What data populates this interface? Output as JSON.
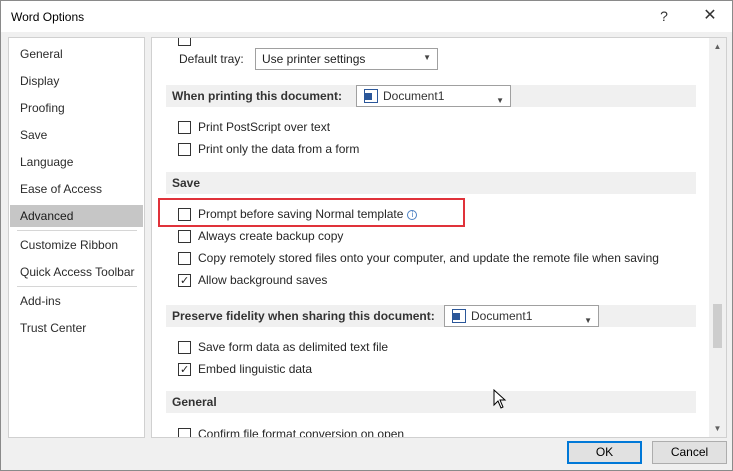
{
  "window": {
    "title": "Word Options"
  },
  "titlebar": {
    "help_glyph": "?",
    "close_glyph": "✕"
  },
  "sidebar": {
    "items": [
      {
        "label": "General"
      },
      {
        "label": "Display"
      },
      {
        "label": "Proofing"
      },
      {
        "label": "Save"
      },
      {
        "label": "Language"
      },
      {
        "label": "Ease of Access"
      },
      {
        "label": "Advanced",
        "selected": true
      },
      {
        "label": "Customize Ribbon"
      },
      {
        "label": "Quick Access Toolbar"
      },
      {
        "label": "Add-ins"
      },
      {
        "label": "Trust Center"
      }
    ]
  },
  "content": {
    "partial_top_text": "",
    "default_tray": {
      "label": "Default tray:",
      "value": "Use printer settings"
    },
    "printing_section": {
      "label": "When printing this document:",
      "document": "Document1"
    },
    "printing_options": [
      {
        "label": "Print PostScript over text",
        "checked": false
      },
      {
        "label": "Print only the data from a form",
        "checked": false
      }
    ],
    "save_section": {
      "label": "Save"
    },
    "save_options": [
      {
        "label": "Prompt before saving Normal template",
        "checked": false,
        "info_icon": true
      },
      {
        "label": "Always create backup copy",
        "checked": false
      },
      {
        "label": "Copy remotely stored files onto your computer, and update the remote file when saving",
        "checked": false
      },
      {
        "label": "Allow background saves",
        "checked": true
      }
    ],
    "fidelity_section": {
      "label": "Preserve fidelity when sharing this document:",
      "document": "Document1"
    },
    "fidelity_options": [
      {
        "label": "Save form data as delimited text file",
        "checked": false
      },
      {
        "label": "Embed linguistic data",
        "checked": true
      }
    ],
    "general_section": {
      "label": "General"
    },
    "general_options": [
      {
        "label": "Confirm file format conversion on open",
        "checked": false
      }
    ]
  },
  "footer": {
    "ok_label": "OK",
    "cancel_label": "Cancel"
  },
  "colors": {
    "highlight": "#e0323a",
    "selected_nav": "#c6c6c6",
    "accent": "#0078d7"
  }
}
